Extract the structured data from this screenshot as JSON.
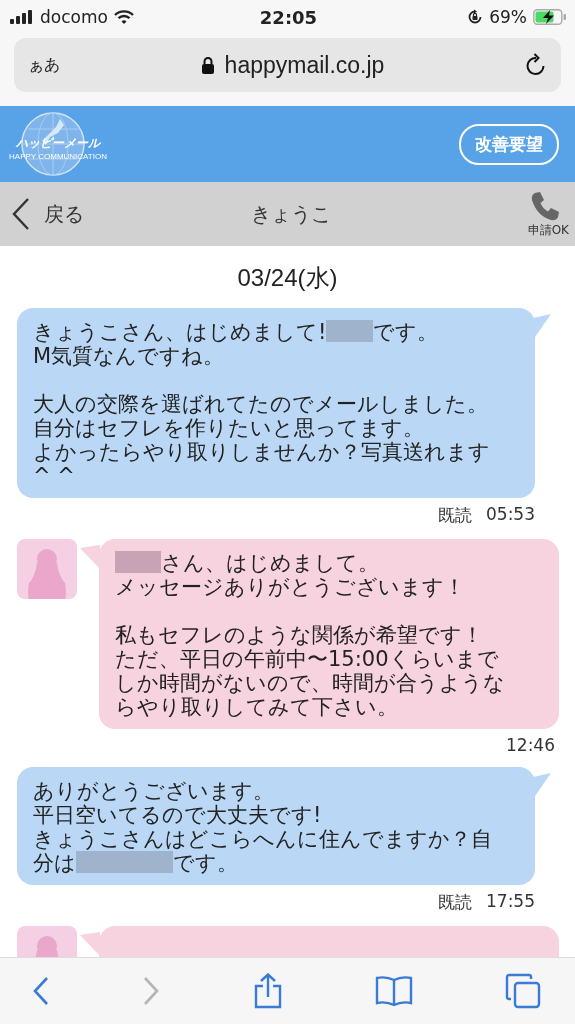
{
  "status_bar": {
    "carrier": "docomo",
    "time": "22:05",
    "battery": "69%"
  },
  "address_bar": {
    "text_size": "ぁあ",
    "url": "happymail.co.jp"
  },
  "site_header": {
    "logo_text": "ハッピーメール",
    "logo_tagline": "HAPPY COMMUNICATION",
    "feedback_button": "改善要望"
  },
  "chat_header": {
    "back": "戻る",
    "title": "きょうこ",
    "call": "申請OK"
  },
  "date": "03/24(水)",
  "messages": [
    {
      "kind": "sent",
      "paragraphs": [
        [
          [
            {
              "kind": "text",
              "text": "きょうこさん、はじめまして!"
            },
            {
              "kind": "redacted"
            },
            {
              "kind": "text",
              "text": "です。"
            }
          ],
          [
            {
              "kind": "text",
              "text": "M気質なんですね。"
            }
          ]
        ],
        [
          [
            {
              "kind": "text",
              "text": "大人の交際を選ばれてたのでメールしました。"
            }
          ],
          [
            {
              "kind": "text",
              "text": "自分はセフレを作りたいと思ってます。"
            }
          ],
          [
            {
              "kind": "text",
              "text": "よかったらやり取りしませんか？写真送れます"
            }
          ],
          [
            {
              "kind": "text",
              "text": "^ ^"
            }
          ]
        ]
      ],
      "read": "既読",
      "time": "05:53"
    },
    {
      "kind": "received",
      "paragraphs": [
        [
          [
            {
              "kind": "redacted"
            },
            {
              "kind": "text",
              "text": "さん、はじめまして。"
            }
          ],
          [
            {
              "kind": "text",
              "text": "メッセージありがとうございます！"
            }
          ]
        ],
        [
          [
            {
              "kind": "text",
              "text": "私もセフレのような関係が希望です！"
            }
          ],
          [
            {
              "kind": "text",
              "text": "ただ、平日の午前中〜15:00くらいまで"
            }
          ],
          [
            {
              "kind": "text",
              "text": "しか時間がないので、時間が合うような"
            }
          ],
          [
            {
              "kind": "text",
              "text": "らやり取りしてみて下さい。"
            }
          ]
        ]
      ],
      "time": "12:46"
    },
    {
      "kind": "sent",
      "paragraphs": [
        [
          [
            {
              "kind": "text",
              "text": "ありがとうございます。"
            }
          ],
          [
            {
              "kind": "text",
              "text": "平日空いてるので大丈夫です!"
            }
          ],
          [
            {
              "kind": "text",
              "text": "きょうこさんはどこらへんに住んでますか？自"
            }
          ],
          [
            {
              "kind": "text",
              "text": "分は"
            },
            {
              "kind": "redacted_long"
            },
            {
              "kind": "text",
              "text": "です。"
            }
          ]
        ]
      ],
      "read": "既読",
      "time": "17:55"
    },
    {
      "kind": "received"
    }
  ],
  "toolbar": [
    {
      "kind": "back",
      "disabled": false
    },
    {
      "kind": "forward",
      "disabled": true
    },
    {
      "kind": "share",
      "disabled": false
    },
    {
      "kind": "bookmarks",
      "disabled": false
    },
    {
      "kind": "tabs",
      "disabled": false
    }
  ]
}
